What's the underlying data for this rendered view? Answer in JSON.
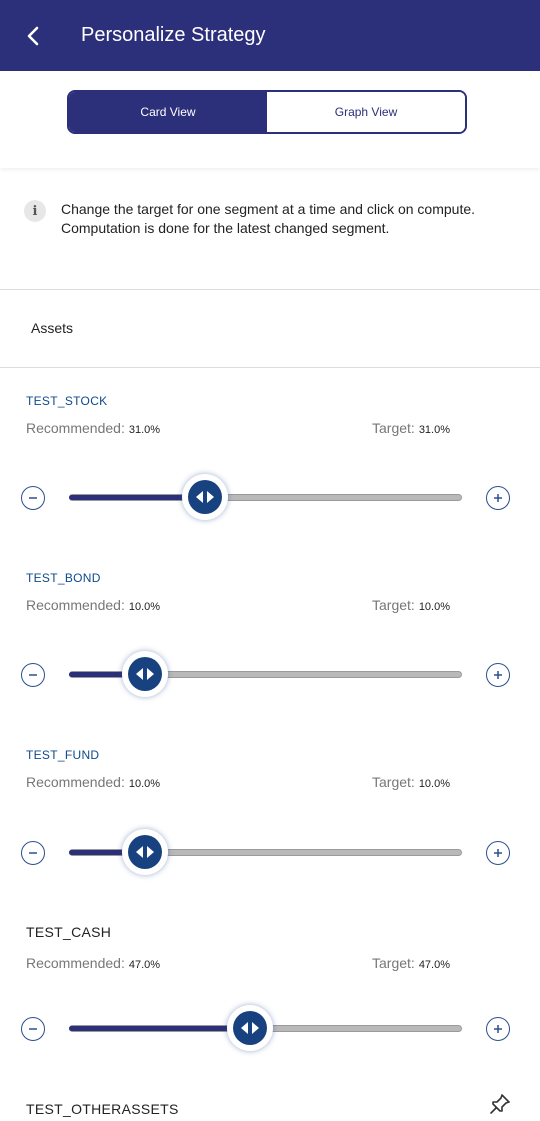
{
  "header": {
    "title": "Personalize Strategy"
  },
  "view_toggle": {
    "card_label": "Card View",
    "graph_label": "Graph View",
    "active": "card"
  },
  "info": {
    "text": "Change the target for one segment at a time and click on compute. Computation is done for the latest changed segment."
  },
  "assets": {
    "heading": "Assets",
    "recommended_label": "Recommended:",
    "target_label": "Target:",
    "segments": [
      {
        "name": "TEST_STOCK",
        "recommended": "31.0%",
        "target": "31.0%",
        "target_value": 31.0
      },
      {
        "name": "TEST_BOND",
        "recommended": "10.0%",
        "target": "10.0%",
        "target_value": 10.0
      },
      {
        "name": "TEST_FUND",
        "recommended": "10.0%",
        "target": "10.0%",
        "target_value": 10.0
      },
      {
        "name": "TEST_CASH",
        "recommended": "47.0%",
        "target": "47.0%",
        "target_value": 47.0
      }
    ],
    "last_segment_name": "TEST_OTHERASSETS"
  },
  "icons": {
    "back": "chevron-left-icon",
    "info": "info-icon",
    "minus": "minus-circle-icon",
    "plus": "plus-circle-icon",
    "thumb": "left-right-arrows-icon",
    "pin": "pin-icon"
  },
  "colors": {
    "primary": "#2c2f7a",
    "thumb": "#17427f",
    "segment_name": "#0e4a8a"
  }
}
